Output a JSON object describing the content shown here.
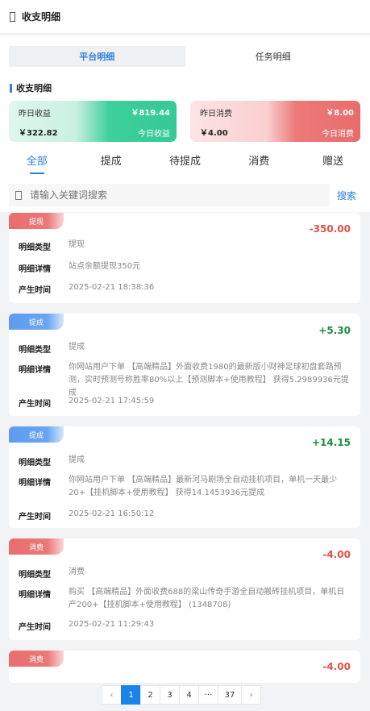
{
  "header": {
    "title": "收支明细"
  },
  "top_tabs": [
    {
      "label": "平台明细"
    },
    {
      "label": "任务明细"
    }
  ],
  "section": {
    "title": "收支明细"
  },
  "stats": {
    "income": {
      "yesterday_label": "昨日收益",
      "yesterday_value": "￥819.44",
      "today_value": "￥322.82",
      "today_label": "今日收益"
    },
    "spend": {
      "yesterday_label": "昨日消费",
      "yesterday_value": "￥8.00",
      "today_value": "￥4.00",
      "today_label": "今日消费"
    }
  },
  "category_tabs": [
    {
      "label": "全部"
    },
    {
      "label": "提成"
    },
    {
      "label": "待提成"
    },
    {
      "label": "消费"
    },
    {
      "label": "赠送"
    }
  ],
  "search": {
    "placeholder": "请输入关键词搜索",
    "button": "搜索"
  },
  "labels": {
    "type": "明细类型",
    "detail": "明细详情",
    "time": "产生时间"
  },
  "records": [
    {
      "tag": "提现",
      "amount": "-350.00",
      "type": "提现",
      "detail": "站点余额提现350元",
      "time": "2025-02-21 18:38:36"
    },
    {
      "tag": "提成",
      "amount": "+5.30",
      "type": "提成",
      "detail": "你网站用户下单 【高端精品】外面收费1980的最新版小财神足球初盘套路预测，实时预测号称胜率80%以上【预测脚本+使用教程】 获得5.2989936元提成",
      "time": "2025-02-21 17:45:59"
    },
    {
      "tag": "提成",
      "amount": "+14.15",
      "type": "提成",
      "detail": "你网站用户下单 【高端精品】最新河马剧场全自动挂机项目，单机一天最少20+【挂机脚本+使用教程】 获得14.1453936元提成",
      "time": "2025-02-21 16:50:12"
    },
    {
      "tag": "消费",
      "amount": "-4.00",
      "type": "消费",
      "detail": "购买 【高端精品】外面收费688的梁山传奇手游全自动搬砖挂机项目，单机日产200+【挂机脚本+使用教程】 (1348708)",
      "time": "2025-02-21 11:29:43"
    },
    {
      "tag": "消费",
      "amount": "-4.00"
    }
  ],
  "pagination": {
    "prev": "‹",
    "pages": [
      "1",
      "2",
      "3",
      "4"
    ],
    "ellipsis": "···",
    "last": "37",
    "next": "›",
    "current": "1"
  }
}
